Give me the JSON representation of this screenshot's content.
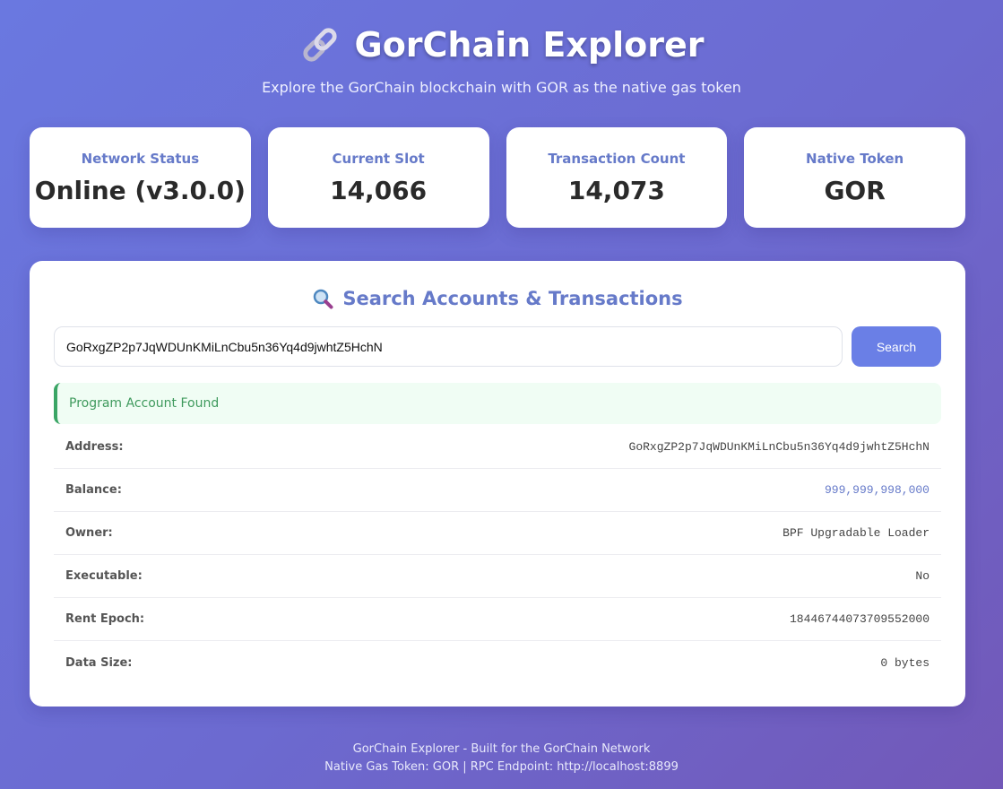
{
  "header": {
    "title": "GorChain Explorer",
    "subtitle": "Explore the GorChain blockchain with GOR as the native gas token",
    "icon": "link-icon"
  },
  "stats": [
    {
      "label": "Network Status",
      "value": "Online (v3.0.0)"
    },
    {
      "label": "Current Slot",
      "value": "14,066"
    },
    {
      "label": "Transaction Count",
      "value": "14,073"
    },
    {
      "label": "Native Token",
      "value": "GOR"
    }
  ],
  "search": {
    "title": "Search Accounts & Transactions",
    "icon": "magnifying-glass-icon",
    "input_value": "GoRxgZP2p7JqWDUnKMiLnCbu5n36Yq4d9jwhtZ5HchN",
    "button_label": "Search"
  },
  "result": {
    "banner": "Program Account Found",
    "details": [
      {
        "label": "Address:",
        "value": "GoRxgZP2p7JqWDUnKMiLnCbu5n36Yq4d9jwhtZ5HchN"
      },
      {
        "label": "Balance:",
        "value": "999,999,998,000"
      },
      {
        "label": "Owner:",
        "value": "BPF Upgradable Loader"
      },
      {
        "label": "Executable:",
        "value": "No"
      },
      {
        "label": "Rent Epoch:",
        "value": "18446744073709552000"
      },
      {
        "label": "Data Size:",
        "value": "0 bytes"
      }
    ]
  },
  "footer": {
    "line1": "GorChain Explorer - Built for the GorChain Network",
    "line2": "Native Gas Token: GOR | RPC Endpoint: http://localhost:8899"
  },
  "colors": {
    "accent": "#667ac9",
    "button": "#6a7fe6",
    "success": "#3aa565"
  }
}
